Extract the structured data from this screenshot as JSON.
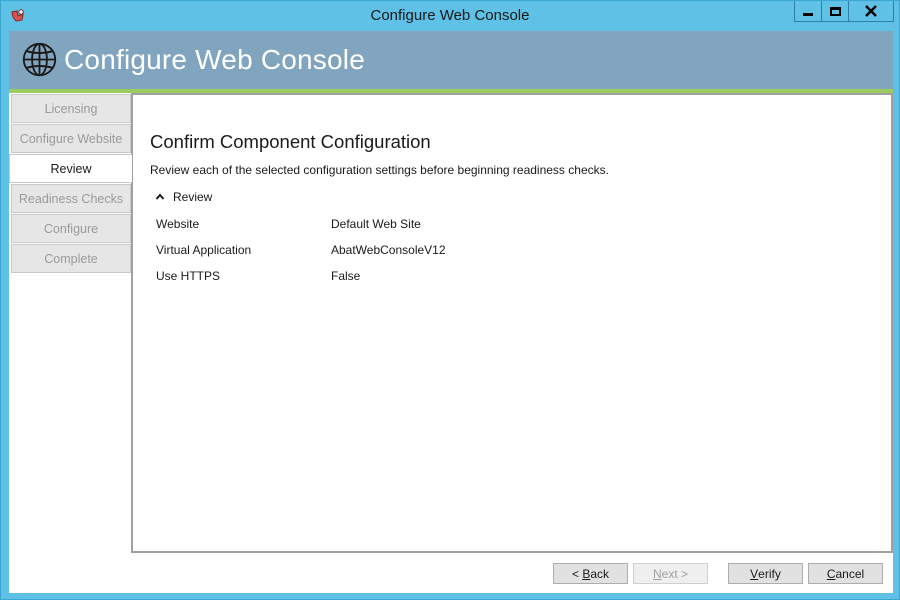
{
  "window": {
    "title": "Configure Web Console",
    "app_icon": "app-logo-icon",
    "controls": {
      "minimize": "minimize-icon",
      "maximize": "maximize-icon",
      "close": "close-icon"
    }
  },
  "banner": {
    "icon": "globe-icon",
    "title": "Configure Web Console"
  },
  "nav": {
    "items": [
      {
        "label": "Licensing",
        "state": "disabled"
      },
      {
        "label": "Configure Website",
        "state": "disabled"
      },
      {
        "label": "Review",
        "state": "active"
      },
      {
        "label": "Readiness Checks",
        "state": "disabled"
      },
      {
        "label": "Configure",
        "state": "disabled"
      },
      {
        "label": "Complete",
        "state": "disabled"
      }
    ]
  },
  "main": {
    "heading": "Confirm Component Configuration",
    "description": "Review each of the selected configuration settings before beginning readiness checks.",
    "section": {
      "label": "Review",
      "icon": "chevron-up-icon",
      "rows": [
        {
          "key": "Website",
          "value": "Default Web Site"
        },
        {
          "key": "Virtual Application",
          "value": "AbatWebConsoleV12"
        },
        {
          "key": "Use HTTPS",
          "value": "False"
        }
      ]
    }
  },
  "footer": {
    "back": {
      "prefix": "< ",
      "mnemonic": "B",
      "rest": "ack"
    },
    "next": {
      "mnemonic": "N",
      "rest": "ext >"
    },
    "verify": {
      "mnemonic": "V",
      "rest": "erify"
    },
    "cancel": {
      "mnemonic": "C",
      "rest": "ancel"
    }
  },
  "colors": {
    "titlebar": "#5fc1e6",
    "banner": "#81a4bf",
    "banner_accent": "#9ccc5e"
  }
}
